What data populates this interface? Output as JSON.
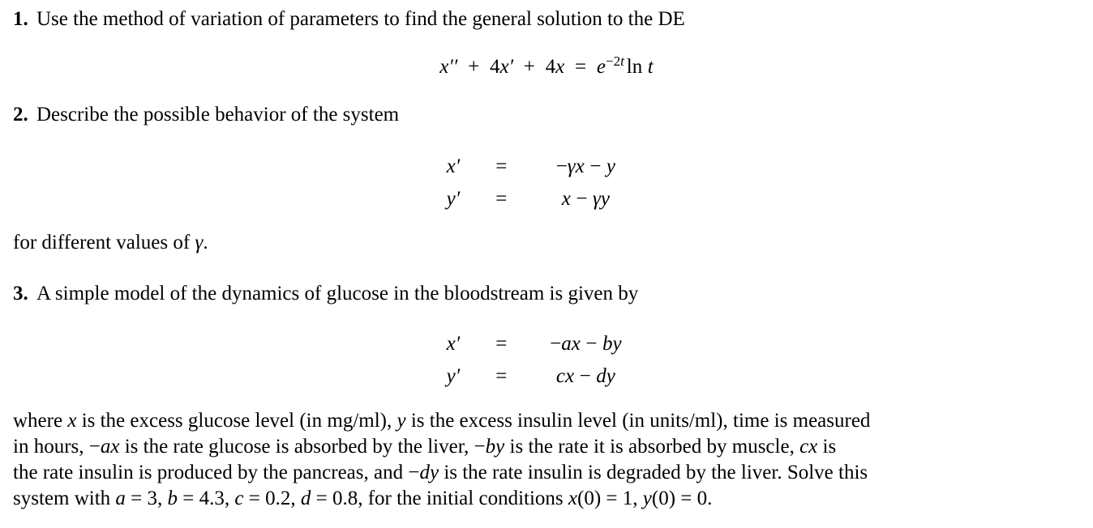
{
  "document": {
    "type": "homework-problem-set",
    "background_color": "#ffffff",
    "text_color": "#000000"
  },
  "problems": [
    {
      "number": "1.",
      "text": "Use the method of variation of parameters to find the general solution to the DE",
      "equation": {
        "kind": "display",
        "latex": "x'' + 4x' + 4x = e^{-2t}\\ln t",
        "plain": "x'' + 4x' + 4x = e^(-2t) ln t",
        "parts": {
          "lhs_var": "x",
          "second_derivative": "x''",
          "first_derivative_coefficient": "4",
          "zeroth_derivative_coefficient": "4",
          "rhs_base": "e",
          "rhs_exponent": "-2t",
          "rhs_function": "ln",
          "rhs_argument": "t"
        }
      }
    },
    {
      "number": "2.",
      "text": "Describe the possible behavior of the system",
      "system": {
        "kind": "aligned-system",
        "rows": [
          {
            "lhs": "x'",
            "rel": "=",
            "rhs": "−γx − y"
          },
          {
            "lhs": "y'",
            "rel": "=",
            "rhs": "x − γy"
          }
        ],
        "latex": "\\begin{aligned} x' &= -\\gamma x - y \\\\ y' &= x - \\gamma y \\end{aligned}"
      },
      "trailer": "for different values of γ."
    },
    {
      "number": "3.",
      "text": "A simple model of the dynamics of glucose in the bloodstream is given by",
      "system": {
        "kind": "aligned-system",
        "rows": [
          {
            "lhs": "x'",
            "rel": "=",
            "rhs": "−ax − by"
          },
          {
            "lhs": "y'",
            "rel": "=",
            "rhs": "cx − dy"
          }
        ],
        "latex": "\\begin{aligned} x' &= -ax - by \\\\ y' &= cx - dy \\end{aligned}"
      },
      "description_lines": [
        "where x is the excess glucose level (in mg/ml), y is the excess insulin level (in units/ml), time is measured",
        "in hours, −ax is the rate glucose is absorbed by the liver, −by is the rate it is absorbed by muscle, cx is",
        "the rate insulin is produced by the pancreas, and −dy is the rate insulin is degraded by the liver. Solve this",
        "system with a = 3, b = 4.3, c = 0.2, d = 0.8, for the initial conditions x(0) = 1, y(0) = 0."
      ],
      "parameters": {
        "a": "3",
        "b": "4.3",
        "c": "0.2",
        "d": "0.8"
      },
      "initial_conditions": {
        "x0": "1",
        "y0": "0"
      },
      "units": {
        "glucose": "mg/ml",
        "insulin": "units/ml",
        "time": "hours"
      }
    }
  ],
  "labels": {
    "trailer_gamma": "for different values of γ.",
    "where_prefix": "where",
    "greek_gamma": "γ",
    "equals": "=",
    "minus": "−"
  }
}
